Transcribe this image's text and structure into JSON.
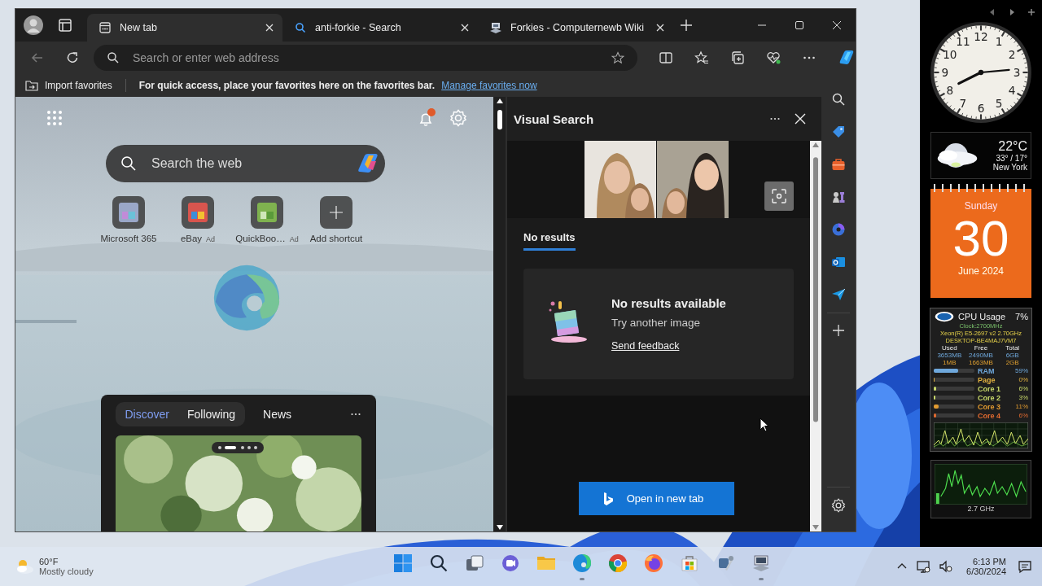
{
  "browser": {
    "tabs": [
      {
        "title": "New tab",
        "selected": true
      },
      {
        "title": "anti-forkie - Search",
        "selected": false
      },
      {
        "title": "Forkies - Computernewb Wiki",
        "selected": false
      }
    ],
    "address_bar": {
      "placeholder": "Search or enter web address"
    },
    "favorites_bar": {
      "import": "Import favorites",
      "message": "For quick access, place your favorites here on the favorites bar.",
      "link": "Manage favorites now"
    }
  },
  "new_tab_page": {
    "search": {
      "placeholder": "Search the web"
    },
    "shortcuts": [
      {
        "kind": "site",
        "label": "Microsoft 365"
      },
      {
        "kind": "site",
        "label": "eBay",
        "badge": "Ad"
      },
      {
        "kind": "site",
        "label": "QuickBoo…",
        "badge": "Ad"
      },
      {
        "kind": "add",
        "label": "Add shortcut"
      }
    ],
    "feed_tabs": [
      {
        "label": "Discover",
        "selected": true
      },
      {
        "label": "Following",
        "selected": false
      },
      {
        "label": "News",
        "selected": false
      }
    ]
  },
  "visual_search": {
    "title": "Visual Search",
    "tab": "No results",
    "message_title": "No results available",
    "message": "Try another image",
    "link": "Send feedback",
    "button": "Open in new tab"
  },
  "gadgets": {
    "clock": {
      "numerals": [
        "12",
        "11",
        "1",
        "10",
        "2",
        "9",
        "3",
        "8",
        "4",
        "7",
        "5",
        "6"
      ]
    },
    "weather": {
      "temperature": "22°C",
      "range": "33° / 17°",
      "city": "New York"
    },
    "calendar": {
      "weekday": "Sunday",
      "day": "30",
      "month": "June 2024"
    },
    "cpu": {
      "title": "CPU Usage",
      "total": "7%",
      "clock": "Clock:2700MHz",
      "processor": "Xeon(R) E5-2697 v2 2.70GHz",
      "host": "DESKTOP-BE4MAJ7VM7",
      "memory_columns": [
        "Used",
        "Free",
        "Total"
      ],
      "memory_rows": [
        [
          "3653MB",
          "2490MB",
          "6GB"
        ],
        [
          "1MB",
          "1663MB",
          "2GB"
        ]
      ],
      "meters": [
        {
          "label": "RAM",
          "reading": "59%",
          "level": 0.59,
          "color": "#6fa8dc"
        },
        {
          "label": "Page",
          "reading": "0%",
          "level": 0,
          "color": "#e0b040"
        },
        {
          "label": "Core 1",
          "reading": "6%",
          "level": 0.06,
          "color": "#c8d86a"
        },
        {
          "label": "Core 2",
          "reading": "3%",
          "level": 0.03,
          "color": "#c8d86a"
        },
        {
          "label": "Core 3",
          "reading": "11%",
          "level": 0.11,
          "color": "#e09a30"
        },
        {
          "label": "Core 4",
          "reading": "6%",
          "level": 0.06,
          "color": "#e06a30"
        }
      ]
    },
    "speed": {
      "reading": "2.7 GHz"
    }
  },
  "taskbar": {
    "weather": {
      "temperature": "60°F",
      "condition": "Mostly cloudy"
    },
    "apps": [
      {
        "kind": "start",
        "active": false
      },
      {
        "kind": "search",
        "active": false
      },
      {
        "kind": "taskview",
        "active": false
      },
      {
        "kind": "chat",
        "active": false
      },
      {
        "kind": "files",
        "active": false
      },
      {
        "kind": "edge",
        "active": true
      },
      {
        "kind": "chrome",
        "active": false
      },
      {
        "kind": "firefox",
        "active": false
      },
      {
        "kind": "store",
        "active": false
      },
      {
        "kind": "tools",
        "active": false
      },
      {
        "kind": "computer",
        "active": true
      }
    ],
    "time": "6:13 PM",
    "date": "6/30/2024"
  }
}
